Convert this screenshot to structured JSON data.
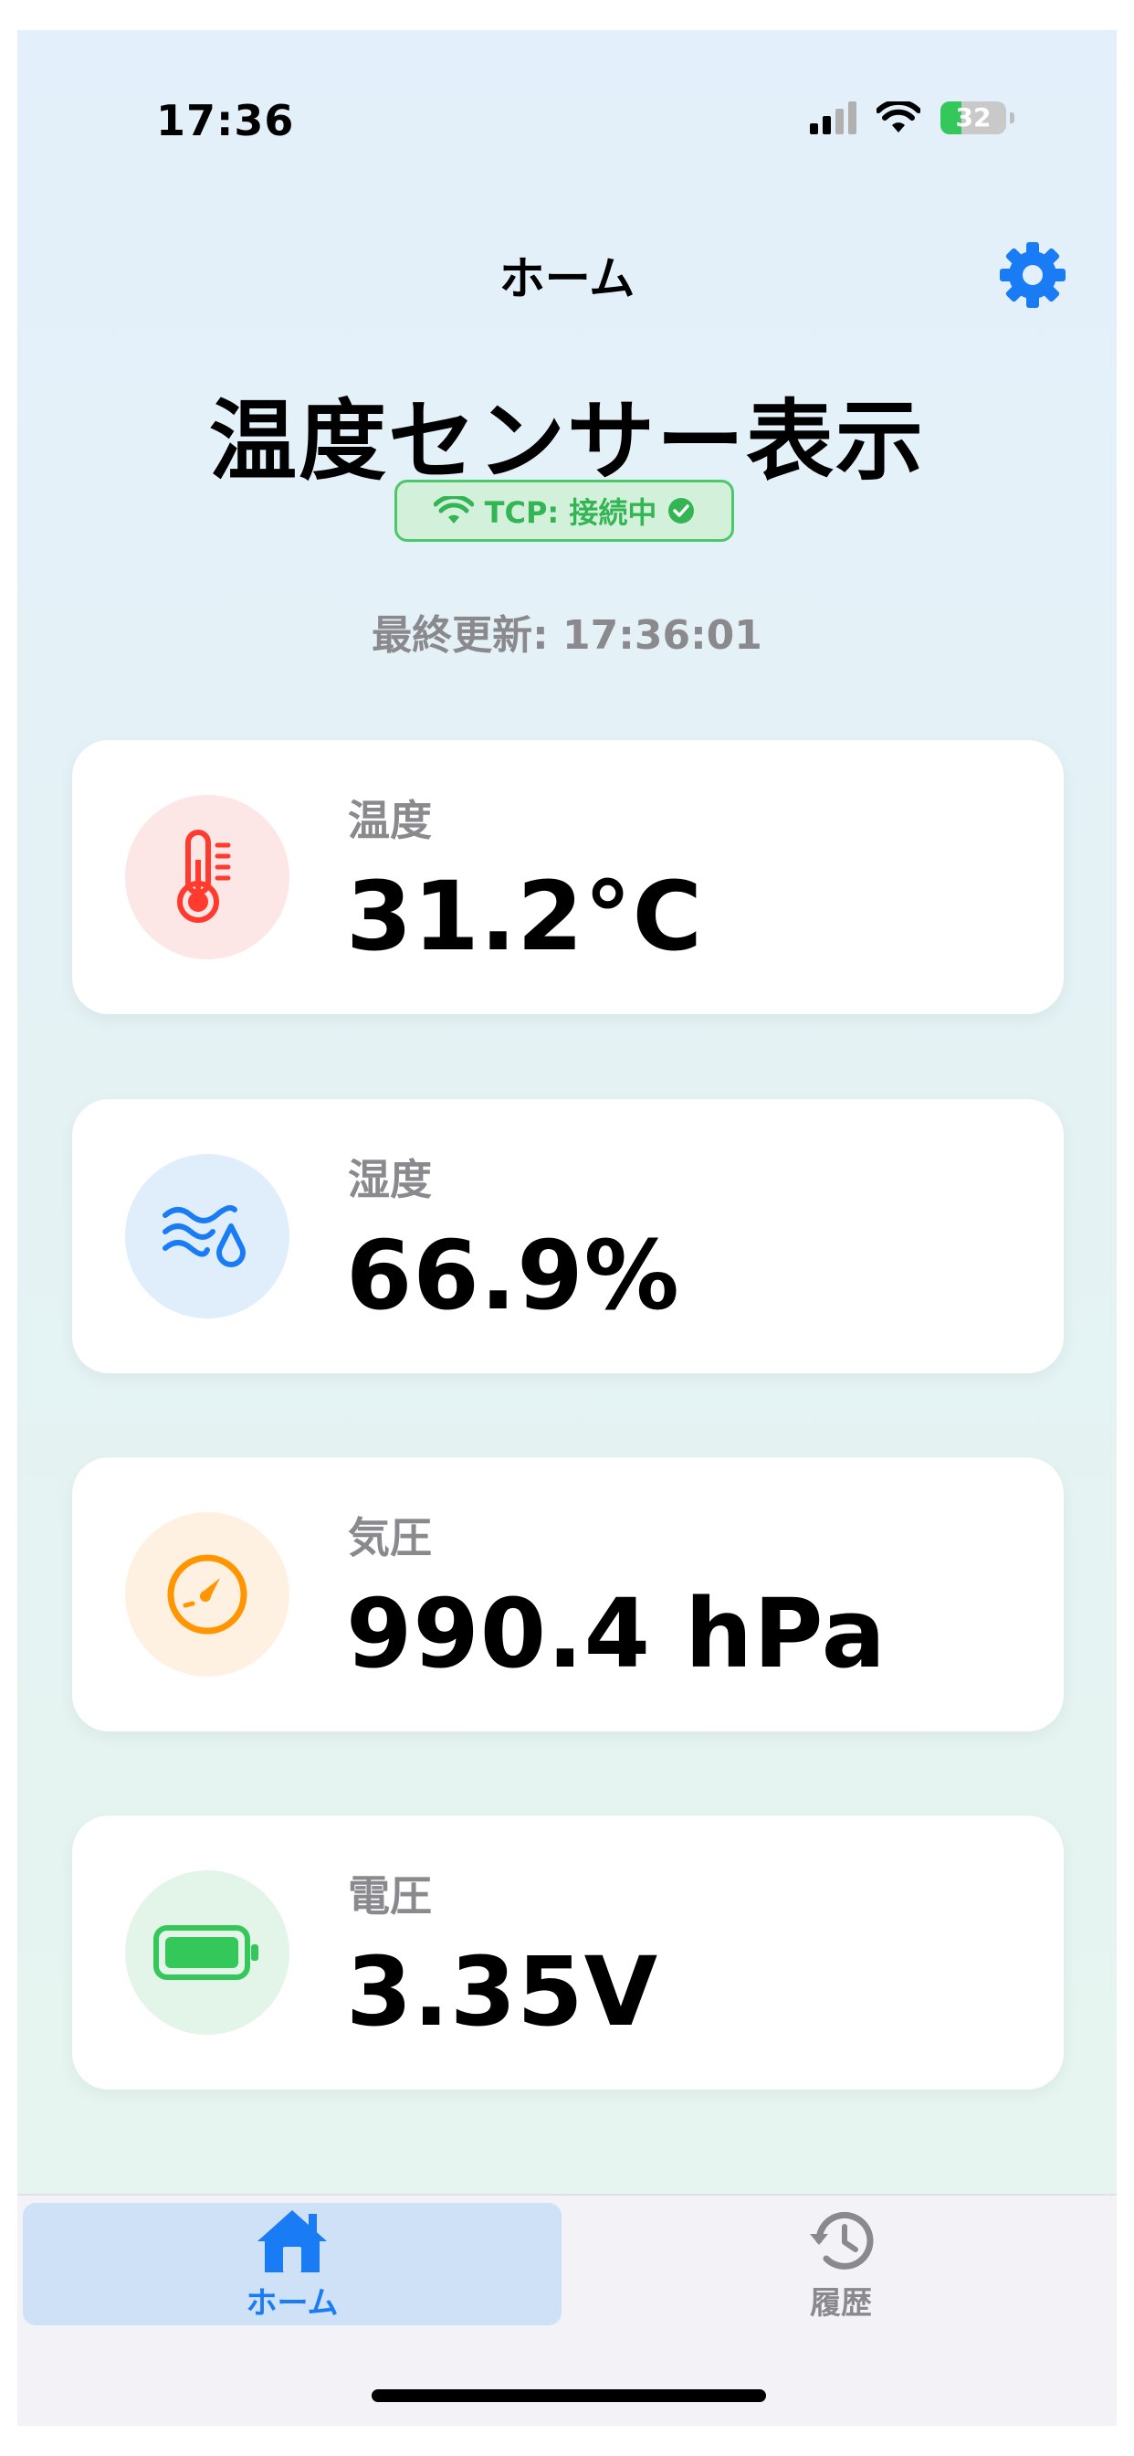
{
  "status_bar": {
    "time": "17:36",
    "battery": "32"
  },
  "nav": {
    "title": "ホーム"
  },
  "header": {
    "title": "温度センサー表示",
    "connection": "TCP: 接続中",
    "last_updated": "最終更新: 17:36:01"
  },
  "readings": [
    {
      "label": "温度",
      "value": "31.2°C",
      "icon": "thermometer-icon",
      "color": "#ff3b30",
      "bg": "#fde6e6"
    },
    {
      "label": "湿度",
      "value": "66.9%",
      "icon": "humidity-icon",
      "color": "#1a7cf5",
      "bg": "#e0edfb"
    },
    {
      "label": "気圧",
      "value": "990.4 hPa",
      "icon": "gauge-icon",
      "color": "#ff9500",
      "bg": "#fef1e2"
    },
    {
      "label": "電圧",
      "value": "3.35V",
      "icon": "battery-icon",
      "color": "#34c759",
      "bg": "#e3f5e8"
    }
  ],
  "tabs": [
    {
      "label": "ホーム",
      "icon": "house-icon",
      "active": true,
      "color": "#1a7cf5"
    },
    {
      "label": "履歴",
      "icon": "history-icon",
      "active": false,
      "color": "#8a8a8e"
    }
  ]
}
